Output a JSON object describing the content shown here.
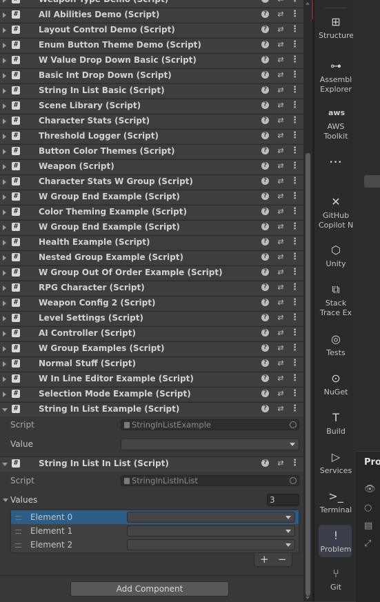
{
  "components": [
    {
      "title": "Weapon Type Demo (Script)",
      "open": false
    },
    {
      "title": "All Abilities Demo (Script)",
      "open": false
    },
    {
      "title": "Layout Control Demo (Script)",
      "open": false
    },
    {
      "title": "Enum Button Theme Demo (Script)",
      "open": false
    },
    {
      "title": "W Value Drop Down Basic (Script)",
      "open": false
    },
    {
      "title": "Basic Int Drop Down (Script)",
      "open": false
    },
    {
      "title": "String In List Basic (Script)",
      "open": false
    },
    {
      "title": "Scene Library (Script)",
      "open": false
    },
    {
      "title": "Character Stats (Script)",
      "open": false
    },
    {
      "title": "Threshold Logger (Script)",
      "open": false
    },
    {
      "title": "Button Color Themes (Script)",
      "open": false
    },
    {
      "title": "Weapon (Script)",
      "open": false
    },
    {
      "title": "Character Stats W Group (Script)",
      "open": false
    },
    {
      "title": "W Group End Example (Script)",
      "open": false
    },
    {
      "title": "Color Theming Example (Script)",
      "open": false
    },
    {
      "title": "W Group End Example (Script)",
      "open": false
    },
    {
      "title": "Health Example (Script)",
      "open": false
    },
    {
      "title": "Nested Group Example (Script)",
      "open": false
    },
    {
      "title": "W Group Out Of Order Example (Script)",
      "open": false
    },
    {
      "title": "RPG Character (Script)",
      "open": false
    },
    {
      "title": "Weapon Config 2 (Script)",
      "open": false
    },
    {
      "title": "Level Settings (Script)",
      "open": false
    },
    {
      "title": "AI Controller (Script)",
      "open": false
    },
    {
      "title": "W Group Examples (Script)",
      "open": false
    },
    {
      "title": "Normal Stuff (Script)",
      "open": false
    },
    {
      "title": "W In Line Editor Example (Script)",
      "open": false
    },
    {
      "title": "Selection Mode Example (Script)",
      "open": false
    },
    {
      "title": "String In List Example (Script)",
      "open": true
    }
  ],
  "string_in_list_example": {
    "script_label": "Script",
    "script_value": "StringInListExample",
    "value_label": "Value",
    "value_selected": ""
  },
  "string_in_list_in_list": {
    "title": "String In List In List (Script)",
    "script_label": "Script",
    "script_value": "StringInListInList",
    "values_label": "Values",
    "values_count": "3",
    "elements": [
      {
        "label": "Element 0",
        "selected": true
      },
      {
        "label": "Element 1",
        "selected": false
      },
      {
        "label": "Element 2",
        "selected": false
      }
    ]
  },
  "list_buttons": {
    "add": "+",
    "remove": "−"
  },
  "add_component_label": "Add Component",
  "header_icons": {
    "help": "?",
    "preset": "⇄",
    "menu": "⋮"
  },
  "dock": [
    {
      "label": "Structure",
      "icon": "structure-icon",
      "glyph": "⊞"
    },
    {
      "label": "Assembly Explorer",
      "icon": "assembly-explorer-icon",
      "glyph": "⊶"
    },
    {
      "label": "AWS Toolkit",
      "icon": "aws-icon",
      "glyph": "aws"
    },
    {
      "label": "",
      "icon": "more-icon",
      "glyph": "•••"
    },
    {
      "label": "GitHub Copilot Chat",
      "icon": "copilot-icon",
      "glyph": "✕"
    },
    {
      "label": "Unity",
      "icon": "unity-icon",
      "glyph": "⬡"
    },
    {
      "label": "Stack Trace Explorer",
      "icon": "stack-trace-icon",
      "glyph": "⧉"
    },
    {
      "label": "Tests",
      "icon": "tests-icon",
      "glyph": "◎"
    },
    {
      "label": "NuGet",
      "icon": "nuget-icon",
      "glyph": "⊙"
    },
    {
      "label": "Build",
      "icon": "build-icon",
      "glyph": "T"
    },
    {
      "label": "Services",
      "icon": "services-icon",
      "glyph": "▷"
    },
    {
      "label": "Terminal",
      "icon": "terminal-icon",
      "glyph": ">_"
    },
    {
      "label": "Problems",
      "icon": "problems-icon",
      "glyph": "!"
    },
    {
      "label": "Git",
      "icon": "git-icon",
      "glyph": "⑂"
    }
  ],
  "right_panel_title": "Prob"
}
